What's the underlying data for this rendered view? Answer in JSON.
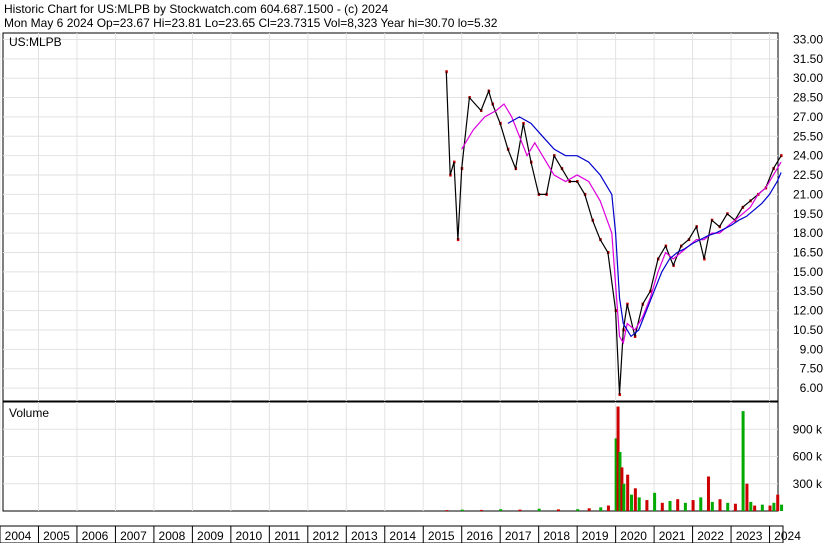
{
  "header": {
    "line1": "Historic Chart for US:MLPB by Stockwatch.com 604.687.1500 - (c) 2024",
    "line2": "Mon May  6 2024   Op=23.67  Hi=23.81  Lo=23.65  Cl=23.7315  Vol=8,323   Year hi=30.70  lo=5.32"
  },
  "chart_data": [
    {
      "type": "line",
      "title": "US:MLPB",
      "y_ticks": [
        "33.00",
        "31.50",
        "30.00",
        "28.50",
        "27.00",
        "25.50",
        "24.00",
        "22.50",
        "21.00",
        "19.50",
        "18.00",
        "16.50",
        "15.00",
        "13.50",
        "12.00",
        "10.50",
        "9.00",
        "7.50",
        "6.00"
      ],
      "x_ticks": [
        "2004",
        "2005",
        "2006",
        "2007",
        "2008",
        "2009",
        "2010",
        "2011",
        "2012",
        "2013",
        "2014",
        "2015",
        "2016",
        "2017",
        "2018",
        "2019",
        "2020",
        "2021",
        "2022",
        "2023",
        "2024"
      ],
      "series": [
        {
          "name": "",
          "color": "#cc0000",
          "x": [
            2015.6,
            2015.7,
            2015.8,
            2015.9,
            2016.0,
            2016.2,
            2016.5,
            2016.7,
            2016.8,
            2017.0,
            2017.2,
            2017.4,
            2017.6,
            2017.8,
            2018.0,
            2018.2,
            2018.4,
            2018.6,
            2018.8,
            2019.0,
            2019.2,
            2019.4,
            2019.6,
            2019.8,
            2020.0,
            2020.1,
            2020.2,
            2020.3,
            2020.5,
            2020.7,
            2020.9,
            2021.1,
            2021.3,
            2021.5,
            2021.7,
            2021.9,
            2022.1,
            2022.3,
            2022.5,
            2022.7,
            2022.9,
            2023.1,
            2023.3,
            2023.5,
            2023.7,
            2023.9,
            2024.1,
            2024.3
          ],
          "y": [
            30.5,
            22.5,
            23.5,
            17.5,
            23.0,
            28.5,
            27.5,
            29.0,
            28.0,
            26.5,
            24.5,
            23.0,
            26.5,
            23.5,
            21.0,
            21.0,
            24.0,
            23.0,
            22.0,
            22.0,
            21.0,
            19.0,
            17.5,
            16.5,
            12.0,
            5.5,
            10.5,
            12.5,
            10.0,
            12.5,
            13.5,
            16.0,
            17.0,
            15.5,
            17.0,
            17.5,
            18.5,
            16.0,
            19.0,
            18.5,
            19.5,
            19.0,
            20.0,
            20.5,
            21.0,
            21.5,
            23.0,
            24.0
          ]
        },
        {
          "name": "",
          "color": "#dd00dd",
          "x": [
            2016.0,
            2016.3,
            2016.6,
            2016.9,
            2017.1,
            2017.3,
            2017.5,
            2017.7,
            2017.9,
            2018.1,
            2018.4,
            2018.7,
            2019.0,
            2019.3,
            2019.6,
            2019.9,
            2020.0,
            2020.1,
            2020.2,
            2020.3,
            2020.5,
            2020.7,
            2020.9,
            2021.1,
            2021.3,
            2021.5,
            2021.7,
            2021.9,
            2022.1,
            2022.3,
            2022.5,
            2022.7,
            2022.9,
            2023.1,
            2023.3,
            2023.5,
            2023.7,
            2023.9,
            2024.1,
            2024.3
          ],
          "y": [
            24.5,
            26.0,
            27.0,
            27.5,
            28.0,
            27.0,
            25.5,
            24.0,
            25.0,
            24.0,
            22.5,
            22.0,
            22.5,
            22.0,
            20.5,
            18.0,
            14.0,
            10.0,
            9.5,
            11.0,
            10.5,
            11.5,
            13.0,
            15.0,
            16.5,
            16.0,
            16.5,
            17.0,
            17.5,
            17.5,
            18.0,
            18.0,
            18.5,
            19.0,
            19.5,
            20.0,
            21.0,
            21.5,
            22.5,
            23.5
          ]
        },
        {
          "name": "",
          "color": "#0000cc",
          "x": [
            2017.2,
            2017.5,
            2017.8,
            2018.1,
            2018.4,
            2018.7,
            2019.0,
            2019.3,
            2019.6,
            2019.9,
            2020.0,
            2020.1,
            2020.2,
            2020.4,
            2020.6,
            2020.8,
            2021.0,
            2021.2,
            2021.4,
            2021.6,
            2021.8,
            2022.0,
            2022.2,
            2022.4,
            2022.6,
            2022.8,
            2023.0,
            2023.2,
            2023.4,
            2023.6,
            2023.8,
            2024.0,
            2024.2,
            2024.3
          ],
          "y": [
            26.5,
            27.0,
            26.5,
            25.5,
            24.5,
            24.0,
            24.0,
            23.5,
            22.5,
            21.0,
            18.0,
            13.0,
            11.0,
            10.0,
            10.5,
            12.0,
            13.5,
            15.0,
            16.0,
            16.5,
            16.8,
            17.2,
            17.5,
            17.8,
            18.0,
            18.3,
            18.6,
            19.0,
            19.3,
            19.8,
            20.3,
            21.0,
            22.0,
            22.7
          ]
        }
      ],
      "ylim": [
        5.0,
        33.5
      ],
      "xlim": [
        2004.0,
        2024.35
      ],
      "grid": true
    },
    {
      "type": "bar",
      "title": "Volume",
      "y_ticks": [
        "900 k",
        "600 k",
        "300 k"
      ],
      "ylim": [
        0,
        1200000
      ],
      "x": [
        2015.6,
        2016.0,
        2016.5,
        2017.0,
        2017.5,
        2018.0,
        2018.5,
        2019.0,
        2019.3,
        2019.6,
        2019.8,
        2020.0,
        2020.05,
        2020.1,
        2020.15,
        2020.2,
        2020.3,
        2020.4,
        2020.5,
        2020.6,
        2020.8,
        2021.0,
        2021.2,
        2021.4,
        2021.6,
        2021.8,
        2022.0,
        2022.2,
        2022.4,
        2022.5,
        2022.7,
        2022.9,
        2023.1,
        2023.3,
        2023.4,
        2023.5,
        2023.6,
        2023.8,
        2024.0,
        2024.1,
        2024.2,
        2024.3
      ],
      "values": [
        10000,
        15000,
        12000,
        20000,
        15000,
        25000,
        18000,
        20000,
        30000,
        40000,
        60000,
        800000,
        1150000,
        650000,
        480000,
        300000,
        400000,
        180000,
        250000,
        150000,
        120000,
        200000,
        90000,
        110000,
        130000,
        90000,
        120000,
        150000,
        380000,
        100000,
        130000,
        90000,
        80000,
        1100000,
        300000,
        100000,
        60000,
        70000,
        60000,
        90000,
        180000,
        70000
      ],
      "colors": [
        "#cc0000",
        "#00aa00"
      ]
    }
  ]
}
